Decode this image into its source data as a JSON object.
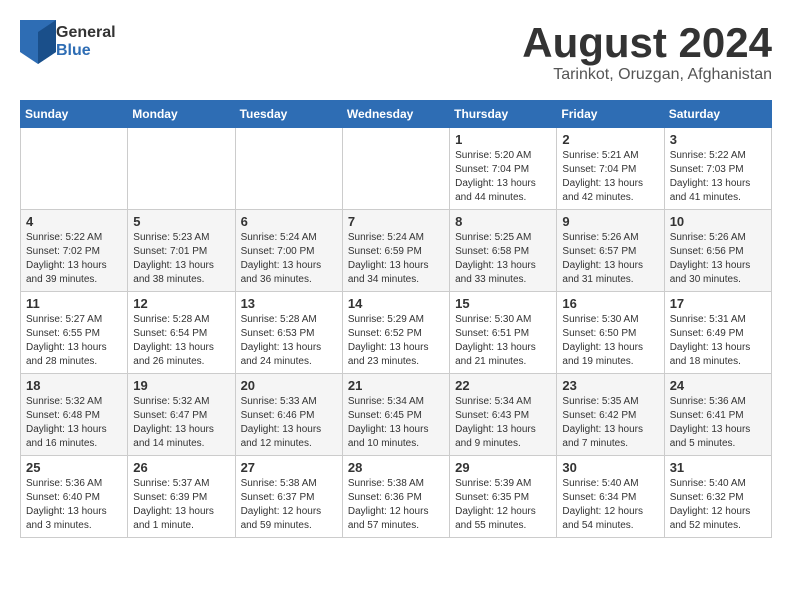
{
  "header": {
    "logo_general": "General",
    "logo_blue": "Blue",
    "title": "August 2024",
    "location": "Tarinkot, Oruzgan, Afghanistan"
  },
  "weekdays": [
    "Sunday",
    "Monday",
    "Tuesday",
    "Wednesday",
    "Thursday",
    "Friday",
    "Saturday"
  ],
  "weeks": [
    [
      {
        "day": "",
        "info": ""
      },
      {
        "day": "",
        "info": ""
      },
      {
        "day": "",
        "info": ""
      },
      {
        "day": "",
        "info": ""
      },
      {
        "day": "1",
        "info": "Sunrise: 5:20 AM\nSunset: 7:04 PM\nDaylight: 13 hours\nand 44 minutes."
      },
      {
        "day": "2",
        "info": "Sunrise: 5:21 AM\nSunset: 7:04 PM\nDaylight: 13 hours\nand 42 minutes."
      },
      {
        "day": "3",
        "info": "Sunrise: 5:22 AM\nSunset: 7:03 PM\nDaylight: 13 hours\nand 41 minutes."
      }
    ],
    [
      {
        "day": "4",
        "info": "Sunrise: 5:22 AM\nSunset: 7:02 PM\nDaylight: 13 hours\nand 39 minutes."
      },
      {
        "day": "5",
        "info": "Sunrise: 5:23 AM\nSunset: 7:01 PM\nDaylight: 13 hours\nand 38 minutes."
      },
      {
        "day": "6",
        "info": "Sunrise: 5:24 AM\nSunset: 7:00 PM\nDaylight: 13 hours\nand 36 minutes."
      },
      {
        "day": "7",
        "info": "Sunrise: 5:24 AM\nSunset: 6:59 PM\nDaylight: 13 hours\nand 34 minutes."
      },
      {
        "day": "8",
        "info": "Sunrise: 5:25 AM\nSunset: 6:58 PM\nDaylight: 13 hours\nand 33 minutes."
      },
      {
        "day": "9",
        "info": "Sunrise: 5:26 AM\nSunset: 6:57 PM\nDaylight: 13 hours\nand 31 minutes."
      },
      {
        "day": "10",
        "info": "Sunrise: 5:26 AM\nSunset: 6:56 PM\nDaylight: 13 hours\nand 30 minutes."
      }
    ],
    [
      {
        "day": "11",
        "info": "Sunrise: 5:27 AM\nSunset: 6:55 PM\nDaylight: 13 hours\nand 28 minutes."
      },
      {
        "day": "12",
        "info": "Sunrise: 5:28 AM\nSunset: 6:54 PM\nDaylight: 13 hours\nand 26 minutes."
      },
      {
        "day": "13",
        "info": "Sunrise: 5:28 AM\nSunset: 6:53 PM\nDaylight: 13 hours\nand 24 minutes."
      },
      {
        "day": "14",
        "info": "Sunrise: 5:29 AM\nSunset: 6:52 PM\nDaylight: 13 hours\nand 23 minutes."
      },
      {
        "day": "15",
        "info": "Sunrise: 5:30 AM\nSunset: 6:51 PM\nDaylight: 13 hours\nand 21 minutes."
      },
      {
        "day": "16",
        "info": "Sunrise: 5:30 AM\nSunset: 6:50 PM\nDaylight: 13 hours\nand 19 minutes."
      },
      {
        "day": "17",
        "info": "Sunrise: 5:31 AM\nSunset: 6:49 PM\nDaylight: 13 hours\nand 18 minutes."
      }
    ],
    [
      {
        "day": "18",
        "info": "Sunrise: 5:32 AM\nSunset: 6:48 PM\nDaylight: 13 hours\nand 16 minutes."
      },
      {
        "day": "19",
        "info": "Sunrise: 5:32 AM\nSunset: 6:47 PM\nDaylight: 13 hours\nand 14 minutes."
      },
      {
        "day": "20",
        "info": "Sunrise: 5:33 AM\nSunset: 6:46 PM\nDaylight: 13 hours\nand 12 minutes."
      },
      {
        "day": "21",
        "info": "Sunrise: 5:34 AM\nSunset: 6:45 PM\nDaylight: 13 hours\nand 10 minutes."
      },
      {
        "day": "22",
        "info": "Sunrise: 5:34 AM\nSunset: 6:43 PM\nDaylight: 13 hours\nand 9 minutes."
      },
      {
        "day": "23",
        "info": "Sunrise: 5:35 AM\nSunset: 6:42 PM\nDaylight: 13 hours\nand 7 minutes."
      },
      {
        "day": "24",
        "info": "Sunrise: 5:36 AM\nSunset: 6:41 PM\nDaylight: 13 hours\nand 5 minutes."
      }
    ],
    [
      {
        "day": "25",
        "info": "Sunrise: 5:36 AM\nSunset: 6:40 PM\nDaylight: 13 hours\nand 3 minutes."
      },
      {
        "day": "26",
        "info": "Sunrise: 5:37 AM\nSunset: 6:39 PM\nDaylight: 13 hours\nand 1 minute."
      },
      {
        "day": "27",
        "info": "Sunrise: 5:38 AM\nSunset: 6:37 PM\nDaylight: 12 hours\nand 59 minutes."
      },
      {
        "day": "28",
        "info": "Sunrise: 5:38 AM\nSunset: 6:36 PM\nDaylight: 12 hours\nand 57 minutes."
      },
      {
        "day": "29",
        "info": "Sunrise: 5:39 AM\nSunset: 6:35 PM\nDaylight: 12 hours\nand 55 minutes."
      },
      {
        "day": "30",
        "info": "Sunrise: 5:40 AM\nSunset: 6:34 PM\nDaylight: 12 hours\nand 54 minutes."
      },
      {
        "day": "31",
        "info": "Sunrise: 5:40 AM\nSunset: 6:32 PM\nDaylight: 12 hours\nand 52 minutes."
      }
    ]
  ]
}
